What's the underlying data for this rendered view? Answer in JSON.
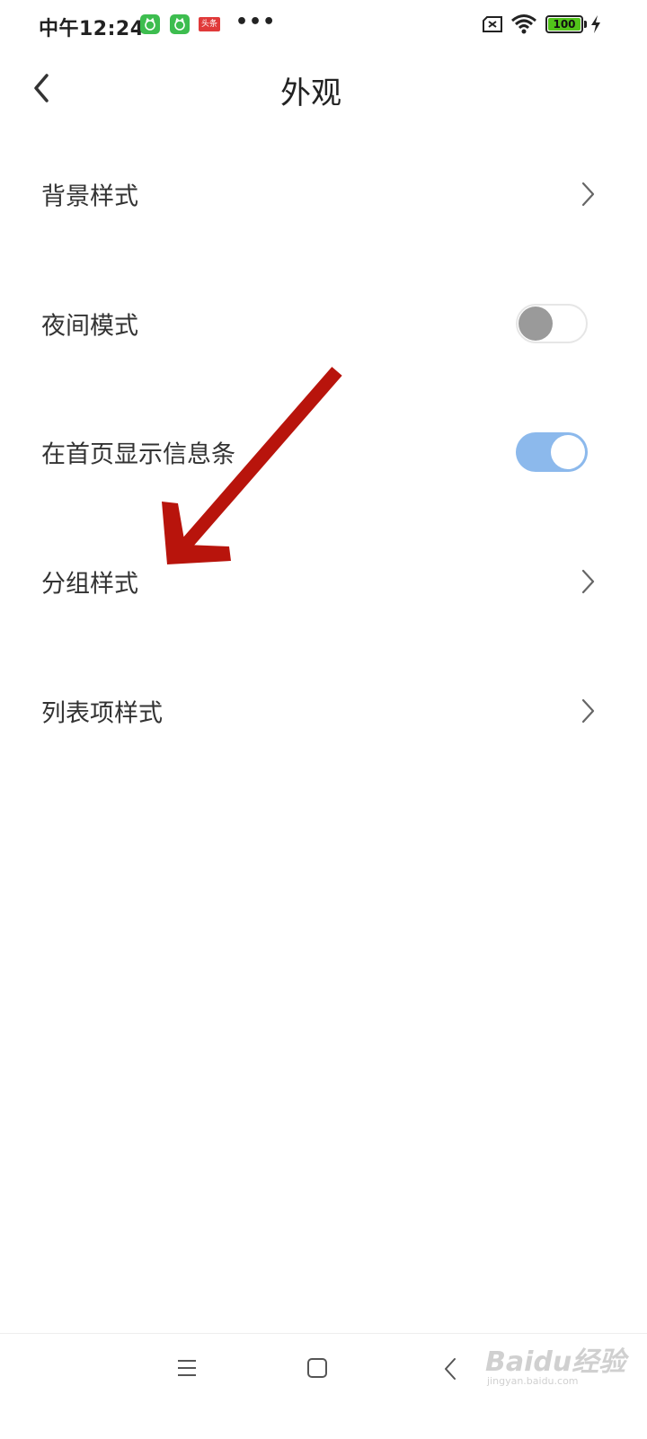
{
  "status_bar": {
    "time": "中午12:24",
    "news_badge": "头条",
    "more": "•••",
    "battery": "100"
  },
  "header": {
    "title": "外观"
  },
  "settings": [
    {
      "label": "背景样式",
      "kind": "link"
    },
    {
      "label": "夜间模式",
      "kind": "toggle",
      "on": false
    },
    {
      "label": "在首页显示信息条",
      "kind": "toggle",
      "on": true
    },
    {
      "label": "分组样式",
      "kind": "link"
    },
    {
      "label": "列表项样式",
      "kind": "link"
    }
  ],
  "watermark": {
    "main": "Baidu经验",
    "sub": "jingyan.baidu.com"
  },
  "colors": {
    "toggle_on": "#8cb9ec",
    "toggle_off_knob": "#9a9a9a",
    "annotation_arrow": "#b8140c",
    "badge_green": "#3dbd4f"
  }
}
